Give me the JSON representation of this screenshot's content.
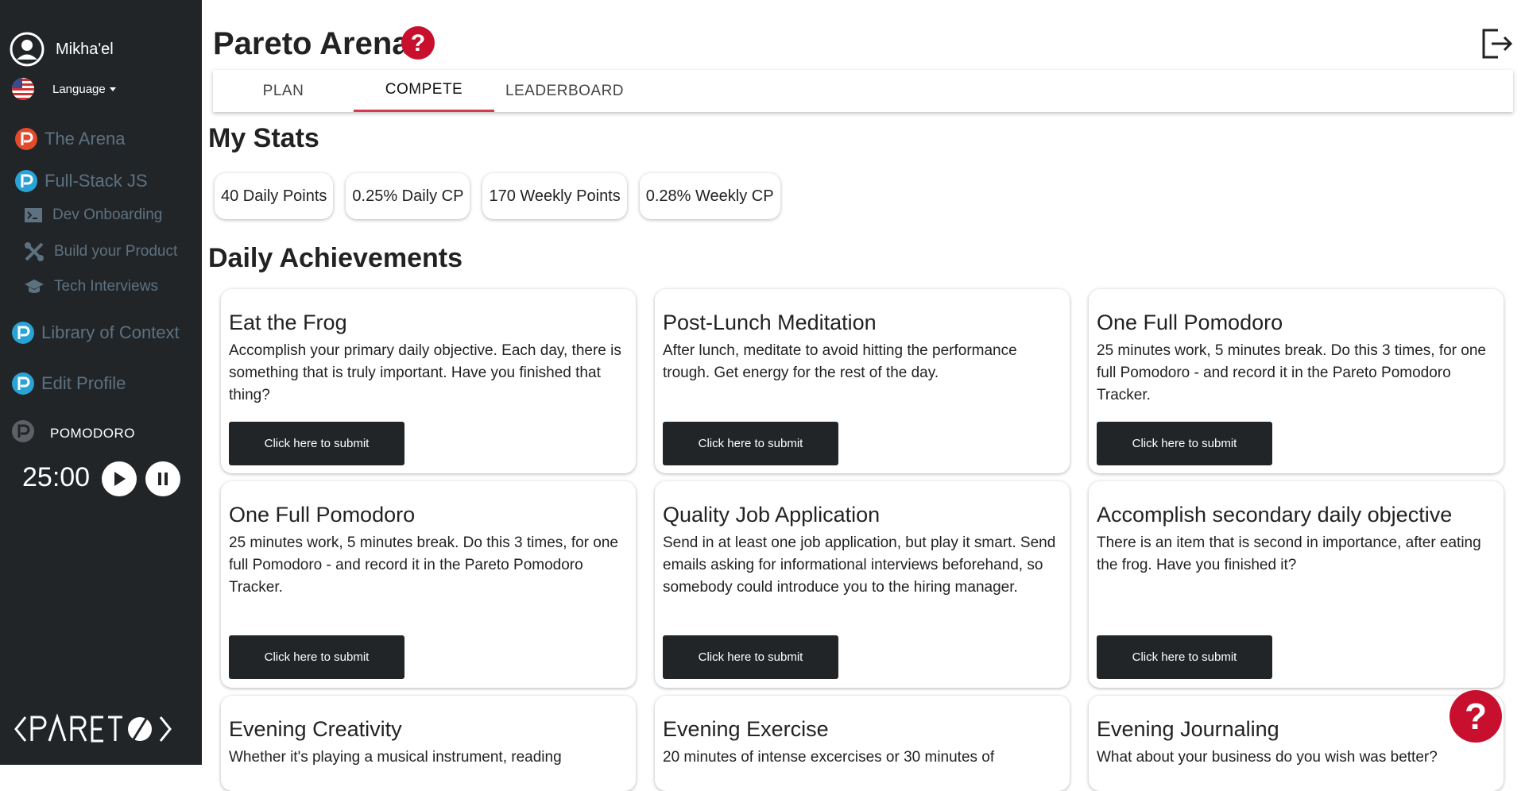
{
  "sidebar": {
    "user_name": "Mikha'el",
    "language_label": "Language",
    "nav": [
      {
        "label": "The Arena",
        "color": "#e24a2b"
      },
      {
        "label": "Full-Stack JS",
        "color": "#29a3d6"
      },
      {
        "label": "Library of Context",
        "color": "#29a3d6"
      },
      {
        "label": "Edit Profile",
        "color": "#29a3d6"
      }
    ],
    "sub_nav": [
      {
        "label": "Dev Onboarding"
      },
      {
        "label": "Build your Product"
      },
      {
        "label": "Tech Interviews"
      }
    ],
    "pomodoro_label": "POMODORO",
    "timer": "25:00",
    "logo_text": "<PARETO>"
  },
  "header": {
    "title": "Pareto Arena"
  },
  "tabs": [
    {
      "label": "PLAN",
      "active": false
    },
    {
      "label": "COMPETE",
      "active": true
    },
    {
      "label": "LEADERBOARD",
      "active": false
    }
  ],
  "stats": {
    "heading": "My Stats",
    "items": [
      "40 Daily Points",
      "0.25% Daily CP",
      "170 Weekly Points",
      "0.28% Weekly CP"
    ]
  },
  "achievements": {
    "heading": "Daily Achievements",
    "submit_label": "Click here to submit",
    "cards": [
      {
        "title": "Eat the Frog",
        "desc": "Accomplish your primary daily objective. Each day, there is something that is truly important. Have you finished that thing?"
      },
      {
        "title": "Post-Lunch Meditation",
        "desc": "After lunch, meditate to avoid hitting the performance trough. Get energy for the rest of the day."
      },
      {
        "title": "One Full Pomodoro",
        "desc": "25 minutes work, 5 minutes break. Do this 3 times, for one full Pomodoro - and record it in the Pareto Pomodoro Tracker."
      },
      {
        "title": "One Full Pomodoro",
        "desc": "25 minutes work, 5 minutes break. Do this 3 times, for one full Pomodoro - and record it in the Pareto Pomodoro Tracker."
      },
      {
        "title": "Quality Job Application",
        "desc": "Send in at least one job application, but play it smart. Send emails asking for informational interviews beforehand, so somebody could introduce you to the hiring manager."
      },
      {
        "title": "Accomplish secondary daily objective",
        "desc": "There is an item that is second in importance, after eating the frog. Have you finished it?"
      },
      {
        "title": "Evening Creativity",
        "desc": "Whether it's playing a musical instrument, reading"
      },
      {
        "title": "Evening Exercise",
        "desc": "20 minutes of intense excercises or 30 minutes of"
      },
      {
        "title": "Evening Journaling",
        "desc": "What about your business do you wish was better?"
      }
    ]
  },
  "colors": {
    "sidebar_bg": "#222528",
    "accent": "#d63a4e",
    "help_red": "#c8102e"
  }
}
